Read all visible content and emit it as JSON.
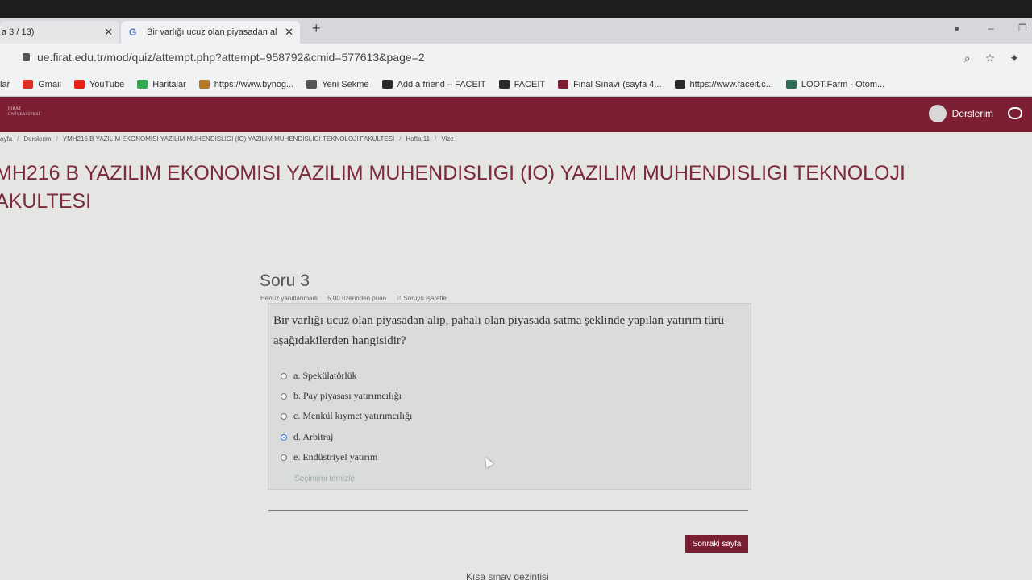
{
  "browser": {
    "tab1_label": "a 3 / 13)",
    "tab2_label": "Bir varlığı ucuz olan piyasadan al",
    "url": "ue.firat.edu.tr/mod/quiz/attempt.php?attempt=958792&cmid=577613&page=2"
  },
  "bookmarks": [
    {
      "label": "lar",
      "color": "transparent"
    },
    {
      "label": "Gmail",
      "color": "#d93025"
    },
    {
      "label": "YouTube",
      "color": "#e62117"
    },
    {
      "label": "Haritalar",
      "color": "#34a853"
    },
    {
      "label": "https://www.bynog...",
      "color": "#b37a2a"
    },
    {
      "label": "Yeni Sekme",
      "color": "#555555"
    },
    {
      "label": "Add a friend – FACEIT",
      "color": "#2b2b2b"
    },
    {
      "label": "FACEIT",
      "color": "#2b2b2b"
    },
    {
      "label": "Final Sınavı (sayfa 4...",
      "color": "#7d1f32"
    },
    {
      "label": "https://www.faceit.c...",
      "color": "#2b2b2b"
    },
    {
      "label": "LOOT.Farm - Otom...",
      "color": "#2f6b57"
    }
  ],
  "navbar": {
    "logo_line1": "FIRAT",
    "logo_line2": "ÜNİVERSİTESİ",
    "user_label": "Derslerim"
  },
  "breadcrumb": [
    "ayfa",
    "Derslerim",
    "YMH216 B YAZILIM EKONOMISI YAZILIM MUHENDISLIGI (IO) YAZILIM MUHENDISLIGI TEKNOLOJI FAKULTESI",
    "Hafta 11",
    "Vize"
  ],
  "course_title_line1": "MH216 B YAZILIM EKONOMISI YAZILIM MUHENDISLIGI (IO) YAZILIM MUHENDISLIGI TEKNOLOJI",
  "course_title_line2": "AKULTESI",
  "question": {
    "heading": "Soru 3",
    "status": "Henüz yanıtlanmadı",
    "points": "5,00 üzerinden puan",
    "flag": "Soruyu işaretle",
    "text": "Bir varlığı ucuz olan piyasadan alıp, pahalı olan piyasada satma şeklinde yapılan yatırım türü aşağıdakilerden hangisidir?",
    "options": [
      "a. Spekülatörlük",
      "b. Pay piyasası yatırımcılığı",
      "c. Menkül kıymet yatırımcılığı",
      "d. Arbitraj",
      "e. Endüstriyel yatırım"
    ],
    "selected_index": 3,
    "clear_label": "Seçimimi temizle"
  },
  "next_button": "Sonraki sayfa",
  "quiz_nav": "Kısa sınav gezintisi"
}
